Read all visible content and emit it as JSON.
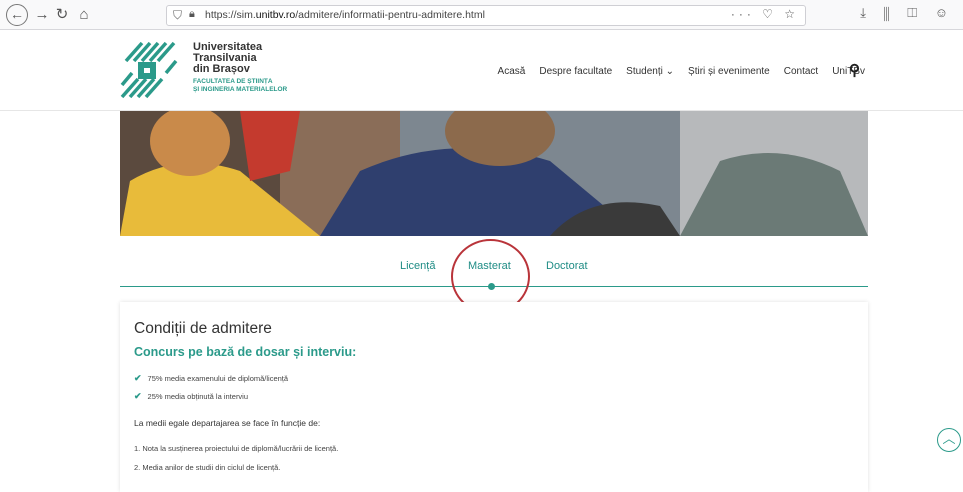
{
  "browser": {
    "back_icon": "arrow-left-icon",
    "forward_icon": "arrow-right-icon",
    "reload_icon": "reload-icon",
    "home_icon": "home-icon",
    "url_prefix": "https://sim.",
    "url_domain": "unitbv.ro",
    "url_path": "/admitere/informatii-pentru-admitere.html",
    "url_actions": "··· ♡ ☆",
    "tools": "⤓ ⫼ ◫ ☺"
  },
  "logo": {
    "line1": "Universitatea",
    "line2": "Transilvania",
    "line3": "din Brașov",
    "faculty1": "FACULTATEA DE ȘTIINȚA",
    "faculty2": "ȘI INGINERIA MATERIALELOR"
  },
  "nav": {
    "items": [
      "Acasă",
      "Despre facultate",
      "Studenți ⌄",
      "Știri și evenimente",
      "Contact",
      "UniTBv"
    ]
  },
  "tabs": {
    "items": [
      "Licență",
      "Masterat",
      "Doctorat"
    ],
    "active": "Masterat"
  },
  "content": {
    "title": "Condiții de admitere",
    "subtitle": "Concurs pe bază de dosar și interviu:",
    "criteria": [
      "75% media examenului de diplomă/licență",
      "25% media obținută la interviu"
    ],
    "tie_note": "La medii egale departajarea se face în funcție de:",
    "tie_items": [
      "1.  Nota la susținerea proiectului de diplomă/lucrării de licență.",
      "2.  Media anilor de studii din ciclul de licență."
    ]
  },
  "colors": {
    "accent": "#2b9a8a",
    "annotation": "#b9343a"
  }
}
